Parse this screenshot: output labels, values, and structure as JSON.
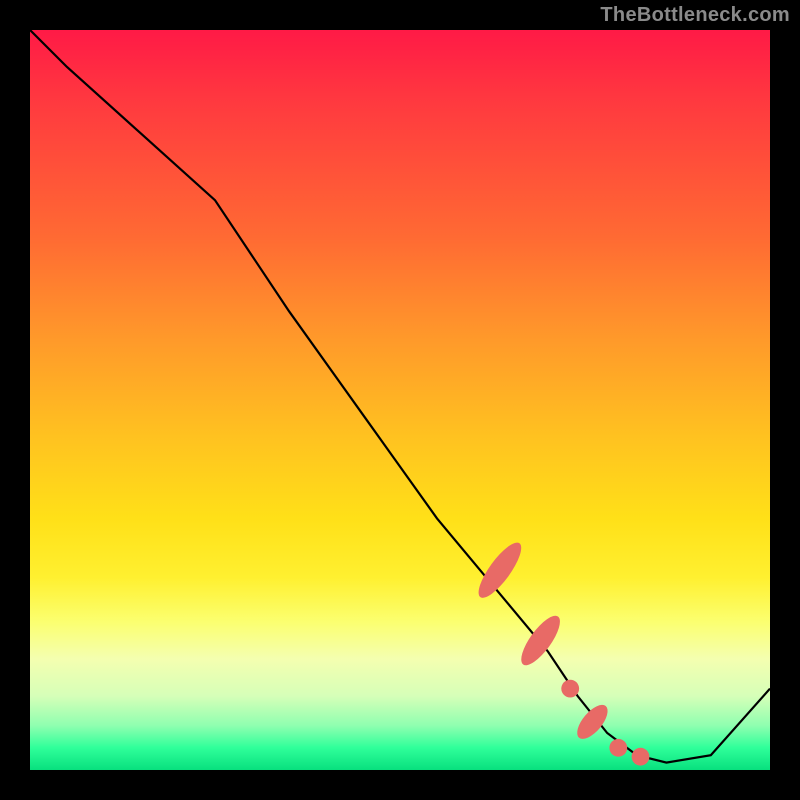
{
  "watermark": "TheBottleneck.com",
  "chart_data": {
    "type": "line",
    "title": "",
    "xlabel": "",
    "ylabel": "",
    "xlim": [
      0,
      100
    ],
    "ylim": [
      0,
      100
    ],
    "grid": false,
    "legend": false,
    "series": [
      {
        "name": "bottleneck-curve",
        "x": [
          0,
          5,
          15,
          25,
          35,
          45,
          55,
          60,
          65,
          70,
          74,
          78,
          82,
          86,
          92,
          100
        ],
        "y": [
          100,
          95,
          86,
          77,
          62,
          48,
          34,
          28,
          22,
          16,
          10,
          5,
          2,
          1,
          2,
          11
        ]
      }
    ],
    "markers": [
      {
        "name": "cluster-upper",
        "cx": 63.5,
        "cy": 27.0,
        "rx": 1.4,
        "ry": 4.5,
        "rotate_deg": 36
      },
      {
        "name": "cluster-mid",
        "cx": 69.0,
        "cy": 17.5,
        "rx": 1.4,
        "ry": 4.0,
        "rotate_deg": 36
      },
      {
        "name": "cluster-dot-a",
        "cx": 73.0,
        "cy": 11.0,
        "rx": 1.2,
        "ry": 1.2,
        "rotate_deg": 0
      },
      {
        "name": "cluster-low",
        "cx": 76.0,
        "cy": 6.5,
        "rx": 1.3,
        "ry": 2.8,
        "rotate_deg": 40
      },
      {
        "name": "cluster-dot-b",
        "cx": 79.5,
        "cy": 3.0,
        "rx": 1.2,
        "ry": 1.2,
        "rotate_deg": 0
      },
      {
        "name": "cluster-bottom",
        "cx": 82.5,
        "cy": 1.8,
        "rx": 1.2,
        "ry": 1.2,
        "rotate_deg": 0
      }
    ],
    "colors": {
      "marker": "#e86a66",
      "line": "#000000"
    }
  }
}
